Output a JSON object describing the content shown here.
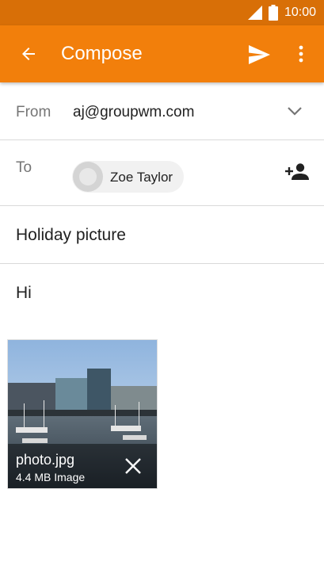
{
  "status_bar": {
    "time": "10:00",
    "icons": [
      "signal-icon",
      "battery-icon"
    ]
  },
  "app_bar": {
    "title": "Compose",
    "back_icon": "arrow-back-icon",
    "send_icon": "send-icon",
    "more_icon": "more-vert-icon"
  },
  "from": {
    "label": "From",
    "value": "aj@groupwm.com",
    "icon": "chevron-down-icon"
  },
  "to": {
    "label": "To",
    "recipient": "Zoe Taylor",
    "add_icon": "add-person-icon"
  },
  "subject": "Holiday picture",
  "body": "Hi",
  "attachment": {
    "filename": "photo.jpg",
    "meta": "4.4 MB Image",
    "remove_icon": "close-icon"
  },
  "colors": {
    "status_bar": "#d86f07",
    "app_bar": "#f27f0b"
  }
}
